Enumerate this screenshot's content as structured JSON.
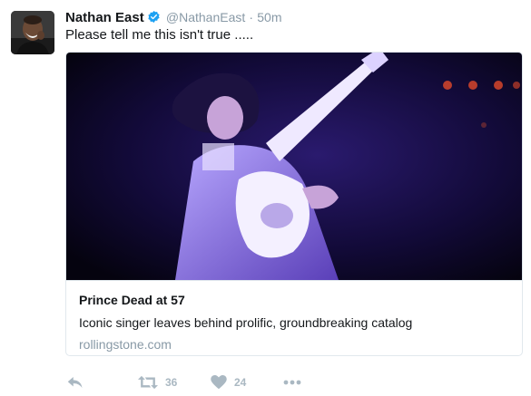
{
  "tweet": {
    "author_name": "Nathan East",
    "handle": "@NathanEast",
    "separator": "·",
    "time": "50m",
    "text": "Please tell me this isn't true .....",
    "card": {
      "title": "Prince Dead at 57",
      "description": "Iconic singer leaves behind prolific, groundbreaking catalog",
      "domain": "rollingstone.com"
    },
    "actions": {
      "retweet_count": "36",
      "like_count": "24"
    }
  },
  "icons": {
    "verified": "verified-badge-icon",
    "reply": "reply-icon",
    "retweet": "retweet-icon",
    "like": "heart-icon",
    "more": "more-dots-icon"
  },
  "colors": {
    "verified_blue": "#1da1f2",
    "muted_text": "#8899a6",
    "action_gray": "#aab8c2",
    "border": "#e1e8ed"
  }
}
